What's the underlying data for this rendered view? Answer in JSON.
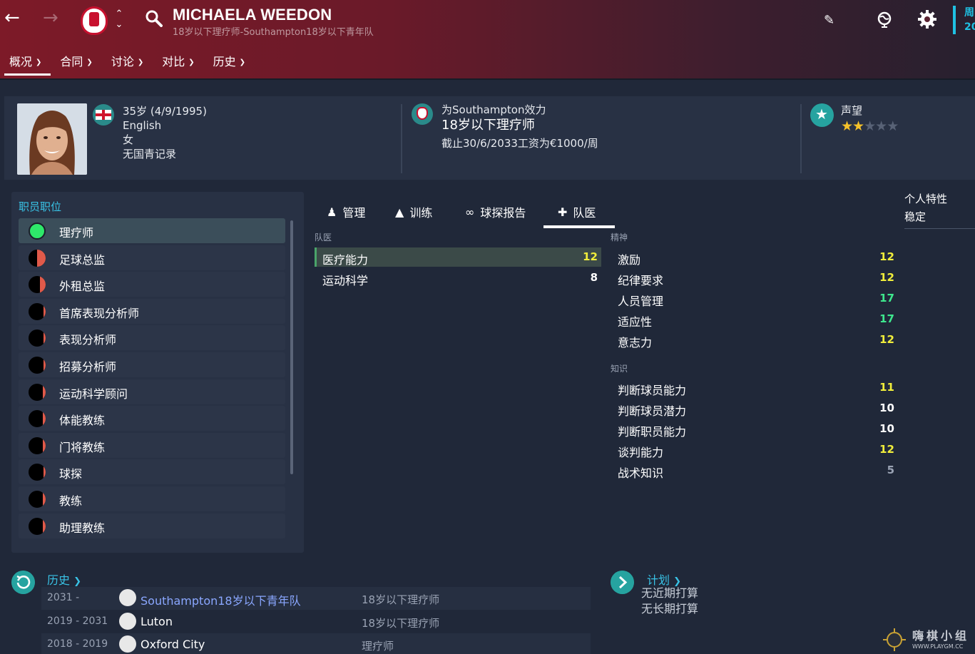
{
  "header": {
    "name": "MICHAELA WEEDON",
    "subtitle": "18岁以下理疗师-Southampton18岁以下青年队",
    "date_line1": "周",
    "date_line2": "20"
  },
  "nav": [
    {
      "label": "概况",
      "active": true
    },
    {
      "label": "合同"
    },
    {
      "label": "讨论"
    },
    {
      "label": "对比"
    },
    {
      "label": "历史"
    }
  ],
  "profile": {
    "age": "35岁 (4/9/1995)",
    "nationality": "English",
    "gender": "女",
    "youth_record": "无国青记录",
    "plays_for": "为Southampton效力",
    "role": "18岁以下理疗师",
    "contract": "截止30/6/2033工资为€1000/周",
    "reputation_label": "声望",
    "reputation_stars": 2,
    "reputation_max": 5
  },
  "roles": {
    "title": "职员职位",
    "items": [
      {
        "label": "理疗师",
        "selected": true,
        "fill": 1.0
      },
      {
        "label": "足球总监",
        "fill": 0.5
      },
      {
        "label": "外租总监",
        "fill": 0.35
      },
      {
        "label": "首席表现分析师",
        "fill": 0.12
      },
      {
        "label": "表现分析师",
        "fill": 0.12
      },
      {
        "label": "招募分析师",
        "fill": 0.12
      },
      {
        "label": "运动科学顾问",
        "fill": 0.15
      },
      {
        "label": "体能教练",
        "fill": 0.15
      },
      {
        "label": "门将教练",
        "fill": 0.15
      },
      {
        "label": "球探",
        "fill": 0.12
      },
      {
        "label": "教练",
        "fill": 0.15
      },
      {
        "label": "助理教练",
        "fill": 0.15
      }
    ]
  },
  "tabs": [
    {
      "label": "管理",
      "icon": "people-icon"
    },
    {
      "label": "训练",
      "icon": "cone-icon"
    },
    {
      "label": "球探报告",
      "icon": "binoculars-icon"
    },
    {
      "label": "队医",
      "icon": "medkit-icon",
      "active": true
    }
  ],
  "medical": {
    "title": "队医",
    "items": [
      {
        "label": "医疗能力",
        "value": "12",
        "color": "#f1ee3b"
      },
      {
        "label": "运动科学",
        "value": "8",
        "color": "#ffffff"
      }
    ]
  },
  "mental": {
    "title": "精神",
    "items": [
      {
        "label": "激励",
        "value": "12",
        "color": "#f1ee3b"
      },
      {
        "label": "纪律要求",
        "value": "12",
        "color": "#f1ee3b"
      },
      {
        "label": "人员管理",
        "value": "17",
        "color": "#3ee88e"
      },
      {
        "label": "适应性",
        "value": "17",
        "color": "#3ee88e"
      },
      {
        "label": "意志力",
        "value": "12",
        "color": "#f1ee3b"
      }
    ]
  },
  "knowledge": {
    "title": "知识",
    "items": [
      {
        "label": "判断球员能力",
        "value": "11",
        "color": "#f1ee3b"
      },
      {
        "label": "判断球员潜力",
        "value": "10",
        "color": "#ffffff"
      },
      {
        "label": "判断职员能力",
        "value": "10",
        "color": "#ffffff"
      },
      {
        "label": "谈判能力",
        "value": "12",
        "color": "#f1ee3b"
      },
      {
        "label": "战术知识",
        "value": "5",
        "color": "#9aa3b4"
      }
    ]
  },
  "traits": {
    "title": "个人特性",
    "value": "稳定"
  },
  "history": {
    "title": "历史",
    "rows": [
      {
        "years": "2031 -",
        "club": "Southampton18岁以下青年队",
        "role": "18岁以下理疗师",
        "link": true
      },
      {
        "years": "2019 - 2031",
        "club": "Luton",
        "role": "18岁以下理疗师"
      },
      {
        "years": "2018 - 2019",
        "club": "Oxford City",
        "role": "理疗师"
      }
    ]
  },
  "plans": {
    "title": "计划",
    "short_term": "无近期打算",
    "long_term": "无长期打算"
  },
  "watermark": {
    "text": "嗨棋小组",
    "url": "WWW.PLAYGM.CC"
  }
}
